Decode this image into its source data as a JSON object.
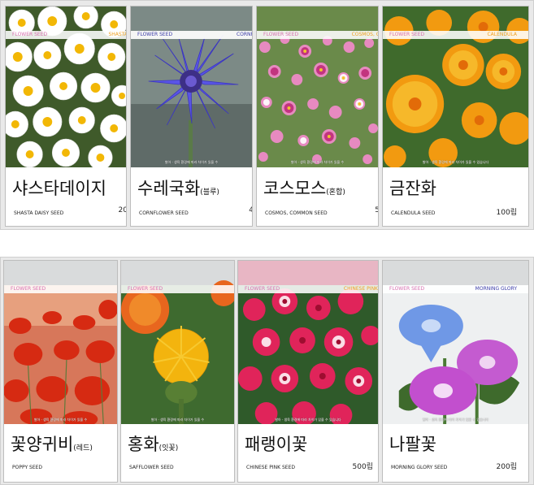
{
  "cards": [
    {
      "seed_tag": "FLOWER SEED",
      "eng_tag": "SHASTA",
      "tag_color": "#f0a020",
      "seed_color": "#d86fb0",
      "name": "샤스타데이지",
      "name_sub": "",
      "eng": "SHASTA DAISY SEED",
      "qty": "20",
      "tiny": ""
    },
    {
      "seed_tag": "FLOWER SEED",
      "eng_tag": "CORNF",
      "tag_color": "#3a3aa8",
      "seed_color": "#3a3aa8",
      "name": "수레국화",
      "name_sub": "(블루)",
      "eng": "CORNFLOWER SEED",
      "qty": "4",
      "tiny": "발아 · 생육 환경에 따라 차이가 있을 수"
    },
    {
      "seed_tag": "FLOWER SEED",
      "eng_tag": "COSMOS, C",
      "tag_color": "#f0a020",
      "seed_color": "#d86fb0",
      "name": "코스모스",
      "name_sub": "(혼합)",
      "eng": "COSMOS, COMMON SEED",
      "qty": "5",
      "tiny": "발아 · 생육 환경에 따라 차이가 있을 수"
    },
    {
      "seed_tag": "FLOWER SEED",
      "eng_tag": "CALENDULA",
      "tag_color": "#f0a020",
      "seed_color": "#d86fb0",
      "name": "금잔화",
      "name_sub": "",
      "eng": "CALENDULA SEED",
      "qty": "100립",
      "tiny": "발아 · 생육 환경에 따라 차이가 있을 수 있습니다"
    },
    {
      "seed_tag": "FLOWER SEED",
      "eng_tag": "",
      "tag_color": "#f0a020",
      "seed_color": "#d86fb0",
      "name": "꽃양귀비",
      "name_sub": "(레드)",
      "eng": "POPPY SEED",
      "qty": "",
      "tiny": "발아 · 생육 환경에 따라 차이가 있을 수"
    },
    {
      "seed_tag": "FLOWER SEED",
      "eng_tag": "",
      "tag_color": "#f0a020",
      "seed_color": "#d86fb0",
      "name": "홍화",
      "name_sub": "(잇꽃)",
      "eng": "SAFFLOWER SEED",
      "qty": "",
      "tiny": "발아 · 생육 환경에 따라 차이가 있을 수"
    },
    {
      "seed_tag": "FLOWER SEED",
      "eng_tag": "CHINESE PINK",
      "tag_color": "#f0a020",
      "seed_color": "#d86fb0",
      "name": "패랭이꽃",
      "name_sub": "",
      "eng": "CHINESE PINK SEED",
      "qty": "500립",
      "tiny": "발아 · 생육 환경에 따라 차이가 있을 수 있습니다"
    },
    {
      "seed_tag": "FLOWER SEED",
      "eng_tag": "MORNING GLORY",
      "tag_color": "#3a3aa8",
      "seed_color": "#d86fb0",
      "name": "나팔꽃",
      "name_sub": "",
      "eng": "MORNING GLORY SEED",
      "qty": "200립",
      "tiny": "발아 · 생육 환경에 따라 차이가 있을 수 있습니다"
    }
  ]
}
